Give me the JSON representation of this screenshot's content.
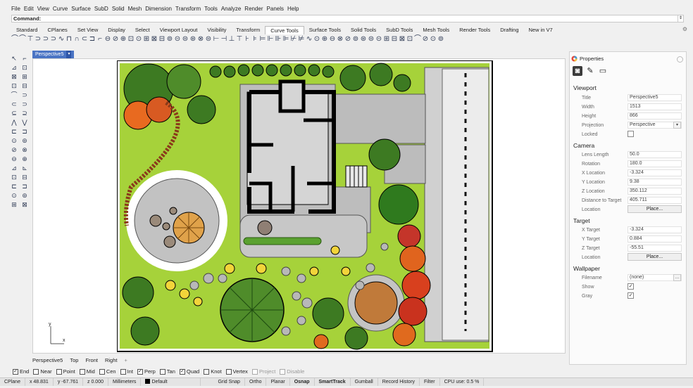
{
  "menu": [
    "File",
    "Edit",
    "View",
    "Curve",
    "Surface",
    "SubD",
    "Solid",
    "Mesh",
    "Dimension",
    "Transform",
    "Tools",
    "Analyze",
    "Render",
    "Panels",
    "Help"
  ],
  "command": {
    "label": "Command:",
    "value": ""
  },
  "toolbar_tabs": [
    "Standard",
    "CPlanes",
    "Set View",
    "Display",
    "Select",
    "Viewport Layout",
    "Visibility",
    "Transform",
    "Curve Tools",
    "Surface Tools",
    "Solid Tools",
    "SubD Tools",
    "Mesh Tools",
    "Render Tools",
    "Drafting",
    "New in V7"
  ],
  "active_tab": "Curve Tools",
  "tool_glyphs": [
    "⌒",
    "⌒",
    "⊤",
    "⊃",
    "⊃",
    "⊃",
    "∿",
    "⊓",
    "∩",
    "⊂",
    "⊐",
    "⌐",
    "⊖",
    "⊘",
    "⊕",
    "⊡",
    "⊙",
    "⊞",
    "⊠",
    "⊟",
    "⊚",
    "⊝",
    "⊜",
    "⊛",
    "⊗",
    "⊜",
    "⊢",
    "⊣",
    "⊥",
    "⊤",
    "⊦",
    "⊧",
    "⊨",
    "⊩",
    "⊪",
    "⊫",
    "⊬",
    "⊭",
    "∿",
    "⊙",
    "⊕",
    "⊖",
    "⊗",
    "⊘",
    "⊚",
    "⊛",
    "⊜",
    "⊝",
    "⊞",
    "⊟",
    "⊠",
    "⊡",
    "⌒",
    "⊘",
    "⊙",
    "⊚"
  ],
  "left_tool_glyphs": [
    "↖",
    "⌐",
    "⊿",
    "⊡",
    "⊠",
    "⊞",
    "⊡",
    "⊟",
    "⌒",
    "⊃",
    "⊂",
    "⊃",
    "⊆",
    "⊇",
    "⋀",
    "⋁",
    "⊏",
    "⊐",
    "⊙",
    "⊚",
    "⊘",
    "⊗",
    "⊖",
    "⊕",
    "⊿",
    "⊾",
    "⊡",
    "⊟",
    "⊏",
    "⊐",
    "⊙",
    "⊚",
    "⊞",
    "⊠"
  ],
  "viewport": {
    "title": "Perspective5",
    "tabs": [
      "Perspective5",
      "Top",
      "Front",
      "Right"
    ],
    "axis_x": "x",
    "axis_y": "y"
  },
  "osnaps": [
    {
      "label": "End",
      "checked": true
    },
    {
      "label": "Near",
      "checked": false
    },
    {
      "label": "Point",
      "checked": false
    },
    {
      "label": "Mid",
      "checked": false
    },
    {
      "label": "Cen",
      "checked": false
    },
    {
      "label": "Int",
      "checked": false
    },
    {
      "label": "Perp",
      "checked": true
    },
    {
      "label": "Tan",
      "checked": false
    },
    {
      "label": "Quad",
      "checked": true
    },
    {
      "label": "Knot",
      "checked": false
    },
    {
      "label": "Vertex",
      "checked": false
    },
    {
      "label": "Project",
      "checked": false,
      "dim": true
    },
    {
      "label": "Disable",
      "checked": false,
      "dim": true
    }
  ],
  "status": {
    "cplane": "CPlane",
    "x": "x 48.831",
    "y": "y -67.761",
    "z": "z 0.000",
    "units": "Millimeters",
    "layer": "Default",
    "grid_snap": "Grid Snap",
    "ortho": "Ortho",
    "planar": "Planar",
    "osnap": "Osnap",
    "smarttrack": "SmartTrack",
    "gumball": "Gumball",
    "record_history": "Record History",
    "filter": "Filter",
    "cpu": "CPU use: 0.5 %"
  },
  "properties": {
    "header": "Properties",
    "viewport_section": "Viewport",
    "title_label": "Title",
    "title_value": "Perspective5",
    "width_label": "Width",
    "width_value": "1513",
    "height_label": "Height",
    "height_value": "866",
    "projection_label": "Projection",
    "projection_value": "Perspective",
    "locked_label": "Locked",
    "camera_section": "Camera",
    "lens_label": "Lens Length",
    "lens_value": "50.0",
    "rotation_label": "Rotation",
    "rotation_value": "180.0",
    "xloc_label": "X Location",
    "xloc_value": "-3.324",
    "yloc_label": "Y Location",
    "yloc_value": "9.38",
    "zloc_label": "Z Location",
    "zloc_value": "350.112",
    "dist_label": "Distance to Target",
    "dist_value": "405.711",
    "cam_location_label": "Location",
    "cam_place": "Place...",
    "target_section": "Target",
    "xt_label": "X Target",
    "xt_value": "-3.324",
    "yt_label": "Y Target",
    "yt_value": "0.884",
    "zt_label": "Z Target",
    "zt_value": "-55.51",
    "tgt_location_label": "Location",
    "tgt_place": "Place...",
    "wallpaper_section": "Wallpaper",
    "filename_label": "Filename",
    "filename_value": "(none)",
    "show_label": "Show",
    "gray_label": "Gray"
  }
}
